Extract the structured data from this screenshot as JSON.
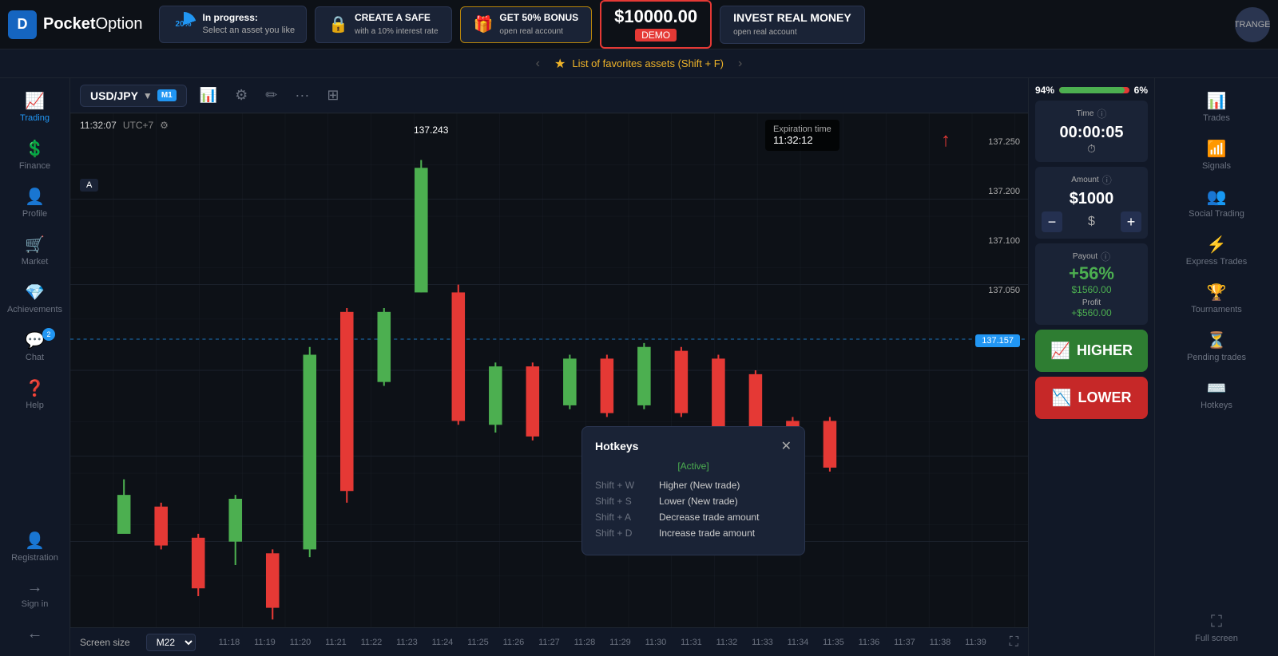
{
  "app": {
    "title": "Pocket Option",
    "logo_letter": "D"
  },
  "topbar": {
    "progress_pct": "20%",
    "progress_label": "In progress:",
    "progress_sub": "Select an asset you like",
    "create_safe_label": "CREATE A SAFE",
    "create_safe_sub": "with a 10% interest rate",
    "bonus_label": "GET 50% BONUS",
    "bonus_sub": "open real account",
    "balance": "$10000.00",
    "demo_label": "DEMO",
    "invest_label": "INVEST REAL MONEY",
    "invest_sub": "open real account",
    "avatar_label": "STRANGER"
  },
  "favbar": {
    "text": "List of favorites assets (Shift + F)"
  },
  "left_nav": {
    "items": [
      {
        "label": "Trading",
        "icon": "📈",
        "active": true
      },
      {
        "label": "Finance",
        "icon": "💲"
      },
      {
        "label": "Profile",
        "icon": "👤"
      },
      {
        "label": "Market",
        "icon": "🛒"
      },
      {
        "label": "Achievements",
        "icon": "💎"
      },
      {
        "label": "Chat",
        "icon": "💬",
        "badge": "2"
      },
      {
        "label": "Help",
        "icon": "❓"
      }
    ],
    "bottom_items": [
      {
        "label": "Registration",
        "icon": "👤+"
      },
      {
        "label": "Sign in",
        "icon": "→"
      }
    ]
  },
  "chart": {
    "asset": "USD/JPY",
    "timeframe": "M1",
    "time": "11:32:07",
    "utc": "UTC+7",
    "expiry_label": "Expiration time",
    "expiry_time": "11:32:12",
    "price": "137.243",
    "current_price": "137.157",
    "price_levels": [
      "137.250",
      "137.200",
      "137.100",
      "137.050"
    ],
    "time_labels": [
      "11:18",
      "11:19",
      "11:20",
      "11:21",
      "11:22",
      "11:23",
      "11:24",
      "11:25",
      "11:26",
      "11:27",
      "11:28",
      "11:29",
      "11:30",
      "11:31",
      "11:32",
      "11:33",
      "11:34",
      "11:35",
      "11:36",
      "11:37",
      "11:38",
      "11:39"
    ]
  },
  "trade_panel": {
    "pct_left": "94%",
    "pct_right": "6%",
    "time_label": "Time",
    "time_value": "00:00:05",
    "amount_label": "Amount",
    "amount_value": "$1000",
    "amount_currency": "$",
    "payout_label": "Payout",
    "payout_pct": "+56%",
    "payout_amount": "$1560.00",
    "profit_label": "Profit",
    "profit_value": "+$560.00",
    "higher_label": "HIGHER",
    "lower_label": "LOWER"
  },
  "right_nav": {
    "items": [
      {
        "label": "Trades",
        "icon": "📊"
      },
      {
        "label": "Signals",
        "icon": "📶"
      },
      {
        "label": "Social Trading",
        "icon": "👥"
      },
      {
        "label": "Express Trades",
        "icon": "⚡"
      },
      {
        "label": "Tournaments",
        "icon": "🏆"
      },
      {
        "label": "Pending trades",
        "icon": "⏳"
      },
      {
        "label": "Hotkeys",
        "icon": "⌨️"
      }
    ]
  },
  "hotkeys": {
    "title": "Hotkeys",
    "status": "[Active]",
    "shortcuts": [
      {
        "combo": "Shift + W",
        "desc": "Higher (New trade)"
      },
      {
        "combo": "Shift + S",
        "desc": "Lower (New trade)"
      },
      {
        "combo": "Shift + A",
        "desc": "Decrease trade amount"
      },
      {
        "combo": "Shift + D",
        "desc": "Increase trade amount"
      }
    ]
  },
  "bottom": {
    "screen_size_label": "Screen size",
    "screen_size_value": "M22"
  }
}
